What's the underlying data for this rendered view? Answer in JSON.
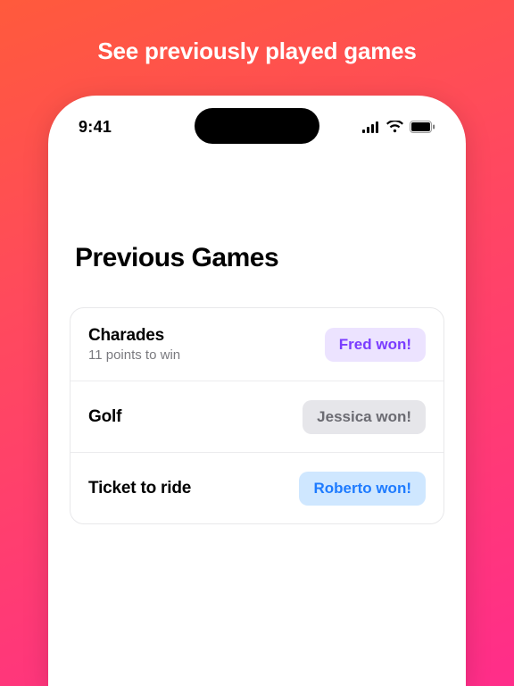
{
  "hero": {
    "title": "See previously played games"
  },
  "status": {
    "time": "9:41"
  },
  "page": {
    "title": "Previous Games"
  },
  "games": [
    {
      "name": "Charades",
      "subtitle": "11 points to win",
      "winner": "Fred won!",
      "style": "purple"
    },
    {
      "name": "Golf",
      "subtitle": "",
      "winner": "Jessica won!",
      "style": "gray"
    },
    {
      "name": "Ticket to ride",
      "subtitle": "",
      "winner": "Roberto won!",
      "style": "blue"
    }
  ]
}
